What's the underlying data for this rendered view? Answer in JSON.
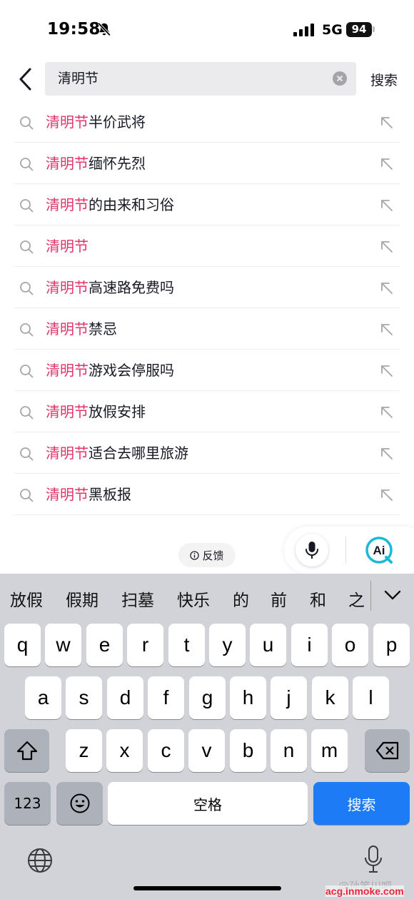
{
  "status_bar": {
    "time": "19:58",
    "network": "5G",
    "battery": "94"
  },
  "search": {
    "query": "清明节",
    "action_label": "搜索"
  },
  "suggestions": [
    {
      "highlight": "清明节",
      "rest": "半价武将"
    },
    {
      "highlight": "清明节",
      "rest": "缅怀先烈"
    },
    {
      "highlight": "清明节",
      "rest": "的由来和习俗"
    },
    {
      "highlight": "清明节",
      "rest": ""
    },
    {
      "highlight": "清明节",
      "rest": "高速路免费吗"
    },
    {
      "highlight": "清明节",
      "rest": "禁忌"
    },
    {
      "highlight": "清明节",
      "rest": "游戏会停服吗"
    },
    {
      "highlight": "清明节",
      "rest": "放假安排"
    },
    {
      "highlight": "清明节",
      "rest": "适合去哪里旅游"
    },
    {
      "highlight": "清明节",
      "rest": "黑板报"
    }
  ],
  "feedback_label": "反馈",
  "ai_label": "Ai",
  "keyboard": {
    "candidates": [
      "放假",
      "假期",
      "扫墓",
      "快乐",
      "的",
      "前",
      "和",
      "之"
    ],
    "row1": [
      "q",
      "w",
      "e",
      "r",
      "t",
      "y",
      "u",
      "i",
      "o",
      "p"
    ],
    "row2": [
      "a",
      "s",
      "d",
      "f",
      "g",
      "h",
      "j",
      "k",
      "l"
    ],
    "row3": [
      "z",
      "x",
      "c",
      "v",
      "b",
      "n",
      "m"
    ],
    "numbers_label": "123",
    "space_label": "空格",
    "return_label": "搜索"
  },
  "watermark": {
    "faint": "@孙笑川吧",
    "main": "acg.inmoke.com"
  },
  "colors": {
    "highlight": "#e3346a",
    "return_key": "#1e7bf6",
    "keyboard_bg": "#d1d3d9"
  }
}
